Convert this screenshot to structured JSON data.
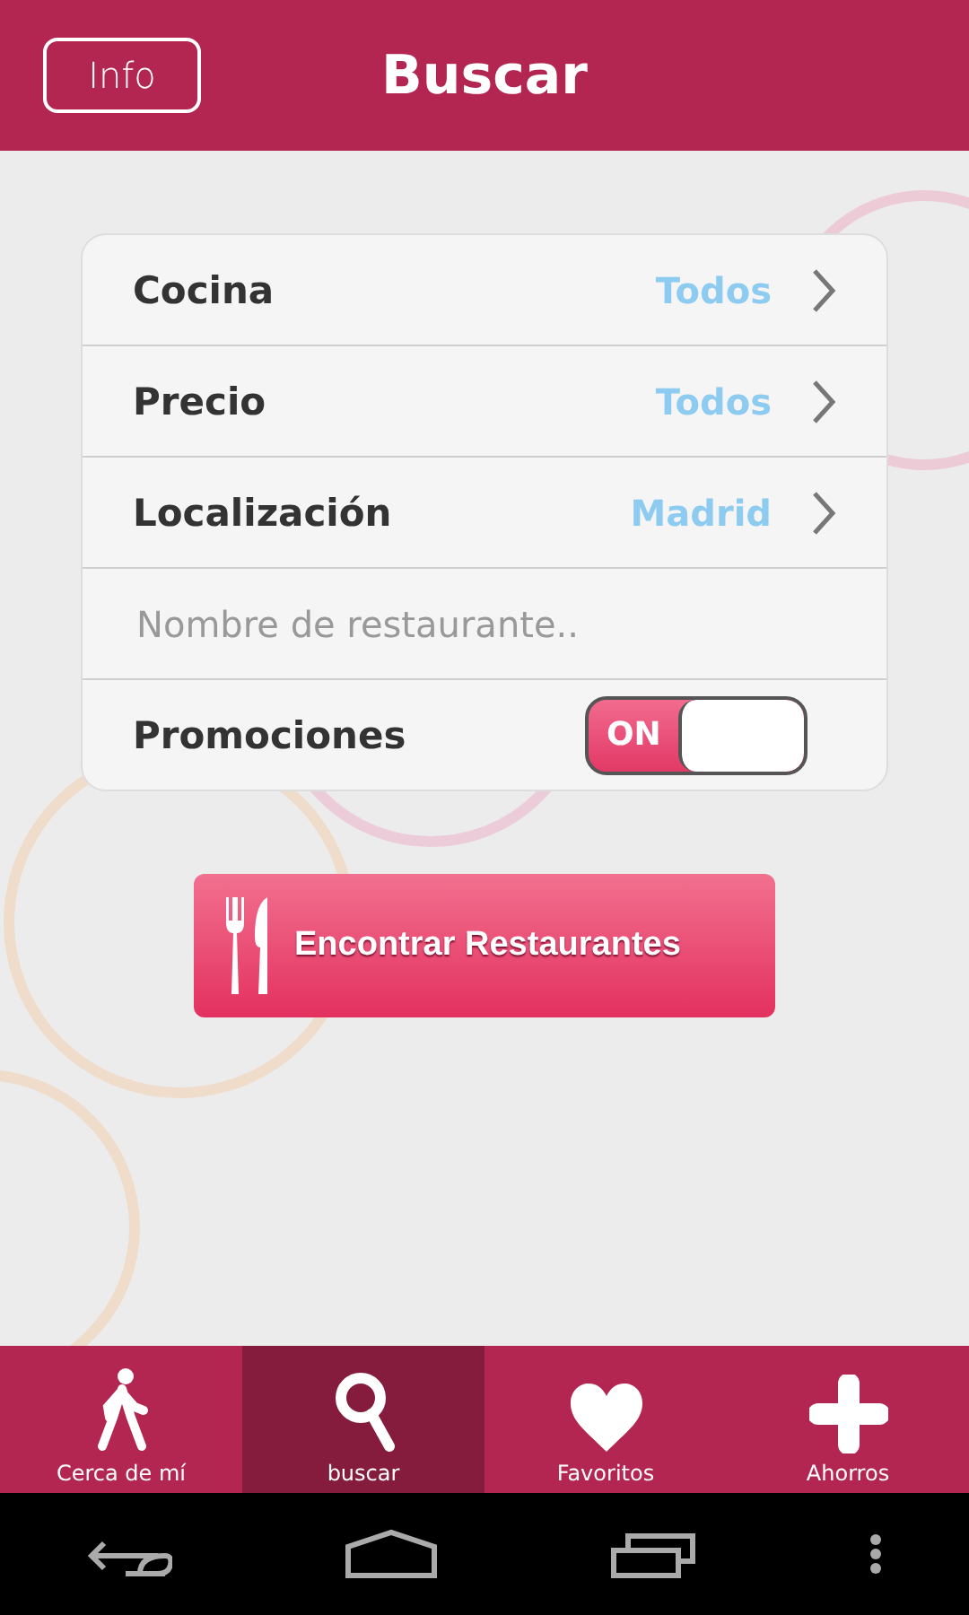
{
  "header": {
    "info_button": "Info",
    "title": "Buscar"
  },
  "form": {
    "rows": [
      {
        "kind": "select",
        "label": "Cocina",
        "value": "Todos"
      },
      {
        "kind": "select",
        "label": "Precio",
        "value": "Todos"
      },
      {
        "kind": "select",
        "label": "Localización",
        "value": "Madrid"
      },
      {
        "kind": "text",
        "placeholder": "Nombre de restaurante.."
      },
      {
        "kind": "toggle",
        "label": "Promociones",
        "on": true,
        "on_label": "ON"
      }
    ]
  },
  "search_button": "Encontrar Restaurantes",
  "tabs": [
    {
      "kind": "walk",
      "label": "Cerca de mí",
      "selected": false
    },
    {
      "kind": "search",
      "label": "buscar",
      "selected": true
    },
    {
      "kind": "heart",
      "label": "Favoritos",
      "selected": false
    },
    {
      "kind": "plus",
      "label": "Ahorros",
      "selected": false
    }
  ]
}
